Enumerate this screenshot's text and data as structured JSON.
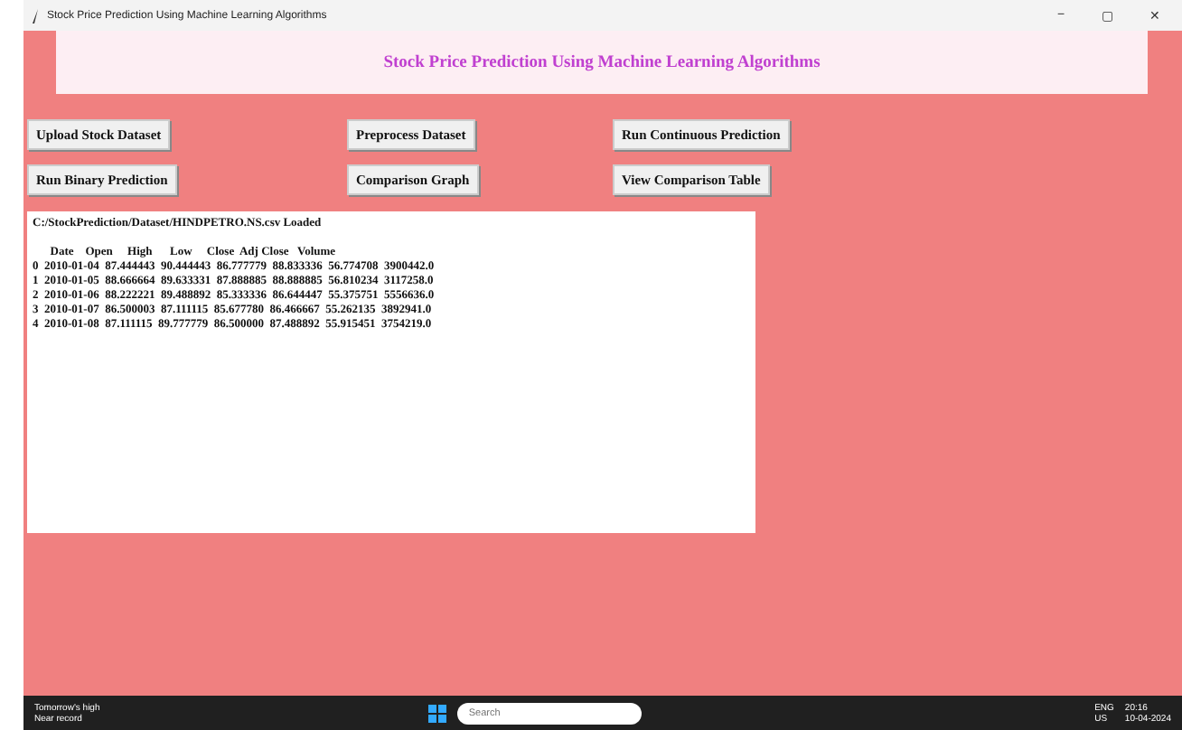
{
  "window": {
    "title": "Stock Price Prediction Using Machine Learning Algorithms",
    "controls": [
      "−",
      "▢",
      "✕"
    ]
  },
  "header": {
    "title": "Stock Price Prediction Using Machine Learning Algorithms"
  },
  "buttons": [
    [
      "Upload Stock Dataset",
      "Preprocess Dataset",
      "Run Continuous Prediction"
    ],
    [
      "Run Binary Prediction",
      "Comparison Graph",
      "View Comparison Table"
    ]
  ],
  "output": {
    "status": "C:/StockPrediction/Dataset/HINDPETRO.NS.csv Loaded",
    "lines": [
      "      Date    Open     High      Low     Close  Adj Close   Volume",
      "0  2010-01-04  87.444443  90.444443  86.777779  88.833336  56.774708  3900442.0",
      "1  2010-01-05  88.666664  89.633331  87.888885  88.888885  56.810234  3117258.0",
      "2  2010-01-06  88.222221  89.488892  85.333336  86.644447  55.375751  5556636.0",
      "3  2010-01-07  86.500003  87.111115  85.677780  86.466667  55.262135  3892941.0",
      "4  2010-01-08  87.111115  89.777779  86.500000  87.488892  55.915451  3754219.0"
    ]
  },
  "taskbar": {
    "weather": [
      "Tomorrow's high",
      "Near record"
    ],
    "search": {
      "placeholder": "Search"
    },
    "language": [
      "ENG",
      "US"
    ],
    "time": "20:16",
    "date": "10-04-2024"
  }
}
